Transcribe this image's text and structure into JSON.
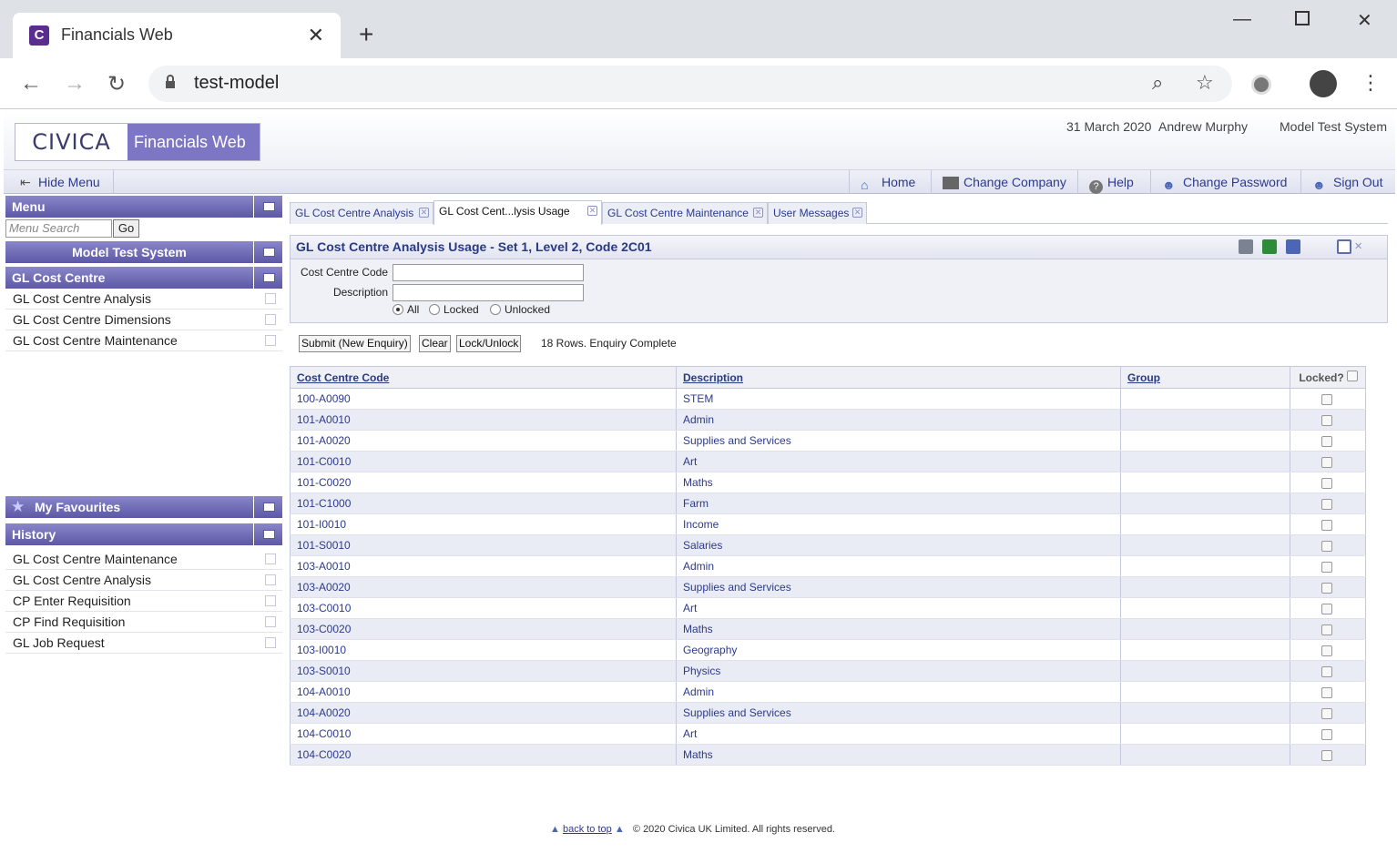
{
  "browser": {
    "tab_title": "Financials Web",
    "favicon_letter": "C",
    "url": "test-model"
  },
  "header": {
    "logo_civica": "CIVICA",
    "logo_product": "Financials Web",
    "date": "31 March 2020",
    "user": "Andrew Murphy",
    "system": "Model Test System"
  },
  "toolbar": {
    "hide_menu": "Hide Menu",
    "home": "Home",
    "change_company": "Change Company",
    "help": "Help",
    "change_password": "Change Password",
    "sign_out": "Sign Out"
  },
  "sidebar": {
    "menu_title": "Menu",
    "search_placeholder": "Menu Search",
    "go_label": "Go",
    "system_title": "Model Test System",
    "section_title": "GL Cost Centre",
    "items": [
      "GL Cost Centre Analysis",
      "GL Cost Centre Dimensions",
      "GL Cost Centre Maintenance"
    ],
    "favourites_title": "My Favourites",
    "history_title": "History",
    "history": [
      "GL Cost Centre Maintenance",
      "GL Cost Centre Analysis",
      "CP Enter Requisition",
      "CP Find Requisition",
      "GL Job Request"
    ]
  },
  "tabs": [
    "GL Cost Centre Analysis",
    "GL Cost Cent...lysis Usage",
    "GL Cost Centre Maintenance",
    "User Messages"
  ],
  "panel": {
    "title": "GL Cost Centre Analysis Usage - Set 1, Level 2, Code 2C01",
    "cost_centre_label": "Cost Centre Code",
    "description_label": "Description",
    "radio_all": "All",
    "radio_locked": "Locked",
    "radio_unlocked": "Unlocked",
    "submit_label": "Submit (New Enquiry)",
    "clear_label": "Clear",
    "lock_label": "Lock/Unlock",
    "status": "18 Rows. Enquiry Complete"
  },
  "table": {
    "headers": [
      "Cost Centre Code",
      "Description",
      "Group",
      "Locked?"
    ],
    "rows": [
      [
        "100-A0090",
        "STEM"
      ],
      [
        "101-A0010",
        "Admin"
      ],
      [
        "101-A0020",
        "Supplies and Services"
      ],
      [
        "101-C0010",
        "Art"
      ],
      [
        "101-C0020",
        "Maths"
      ],
      [
        "101-C1000",
        "Farm"
      ],
      [
        "101-I0010",
        "Income"
      ],
      [
        "101-S0010",
        "Salaries"
      ],
      [
        "103-A0010",
        "Admin"
      ],
      [
        "103-A0020",
        "Supplies and Services"
      ],
      [
        "103-C0010",
        "Art"
      ],
      [
        "103-C0020",
        "Maths"
      ],
      [
        "103-I0010",
        "Geography"
      ],
      [
        "103-S0010",
        "Physics"
      ],
      [
        "104-A0010",
        "Admin"
      ],
      [
        "104-A0020",
        "Supplies and Services"
      ],
      [
        "104-C0010",
        "Art"
      ],
      [
        "104-C0020",
        "Maths"
      ]
    ]
  },
  "footer": {
    "back_to_top": "back to top",
    "copyright": "© 2020 Civica UK Limited. All rights reserved."
  }
}
